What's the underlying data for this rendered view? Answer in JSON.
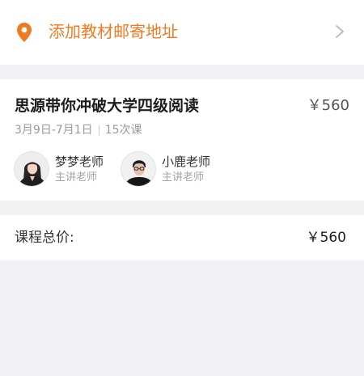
{
  "address": {
    "label": "添加教材邮寄地址",
    "icon": "location-pin-icon",
    "accent_color": "#f07a22",
    "chevron_icon": "chevron-right-icon"
  },
  "course": {
    "title": "思源带你冲破大学四级阅读",
    "price": "￥560",
    "date_range": "3月9日-7月1日",
    "lessons": "15次课",
    "teachers": [
      {
        "name": "梦梦老师",
        "role": "主讲老师",
        "avatar": "avatar-female"
      },
      {
        "name": "小鹿老师",
        "role": "主讲老师",
        "avatar": "avatar-male"
      }
    ]
  },
  "total": {
    "label": "课程总价:",
    "value": "￥560"
  }
}
